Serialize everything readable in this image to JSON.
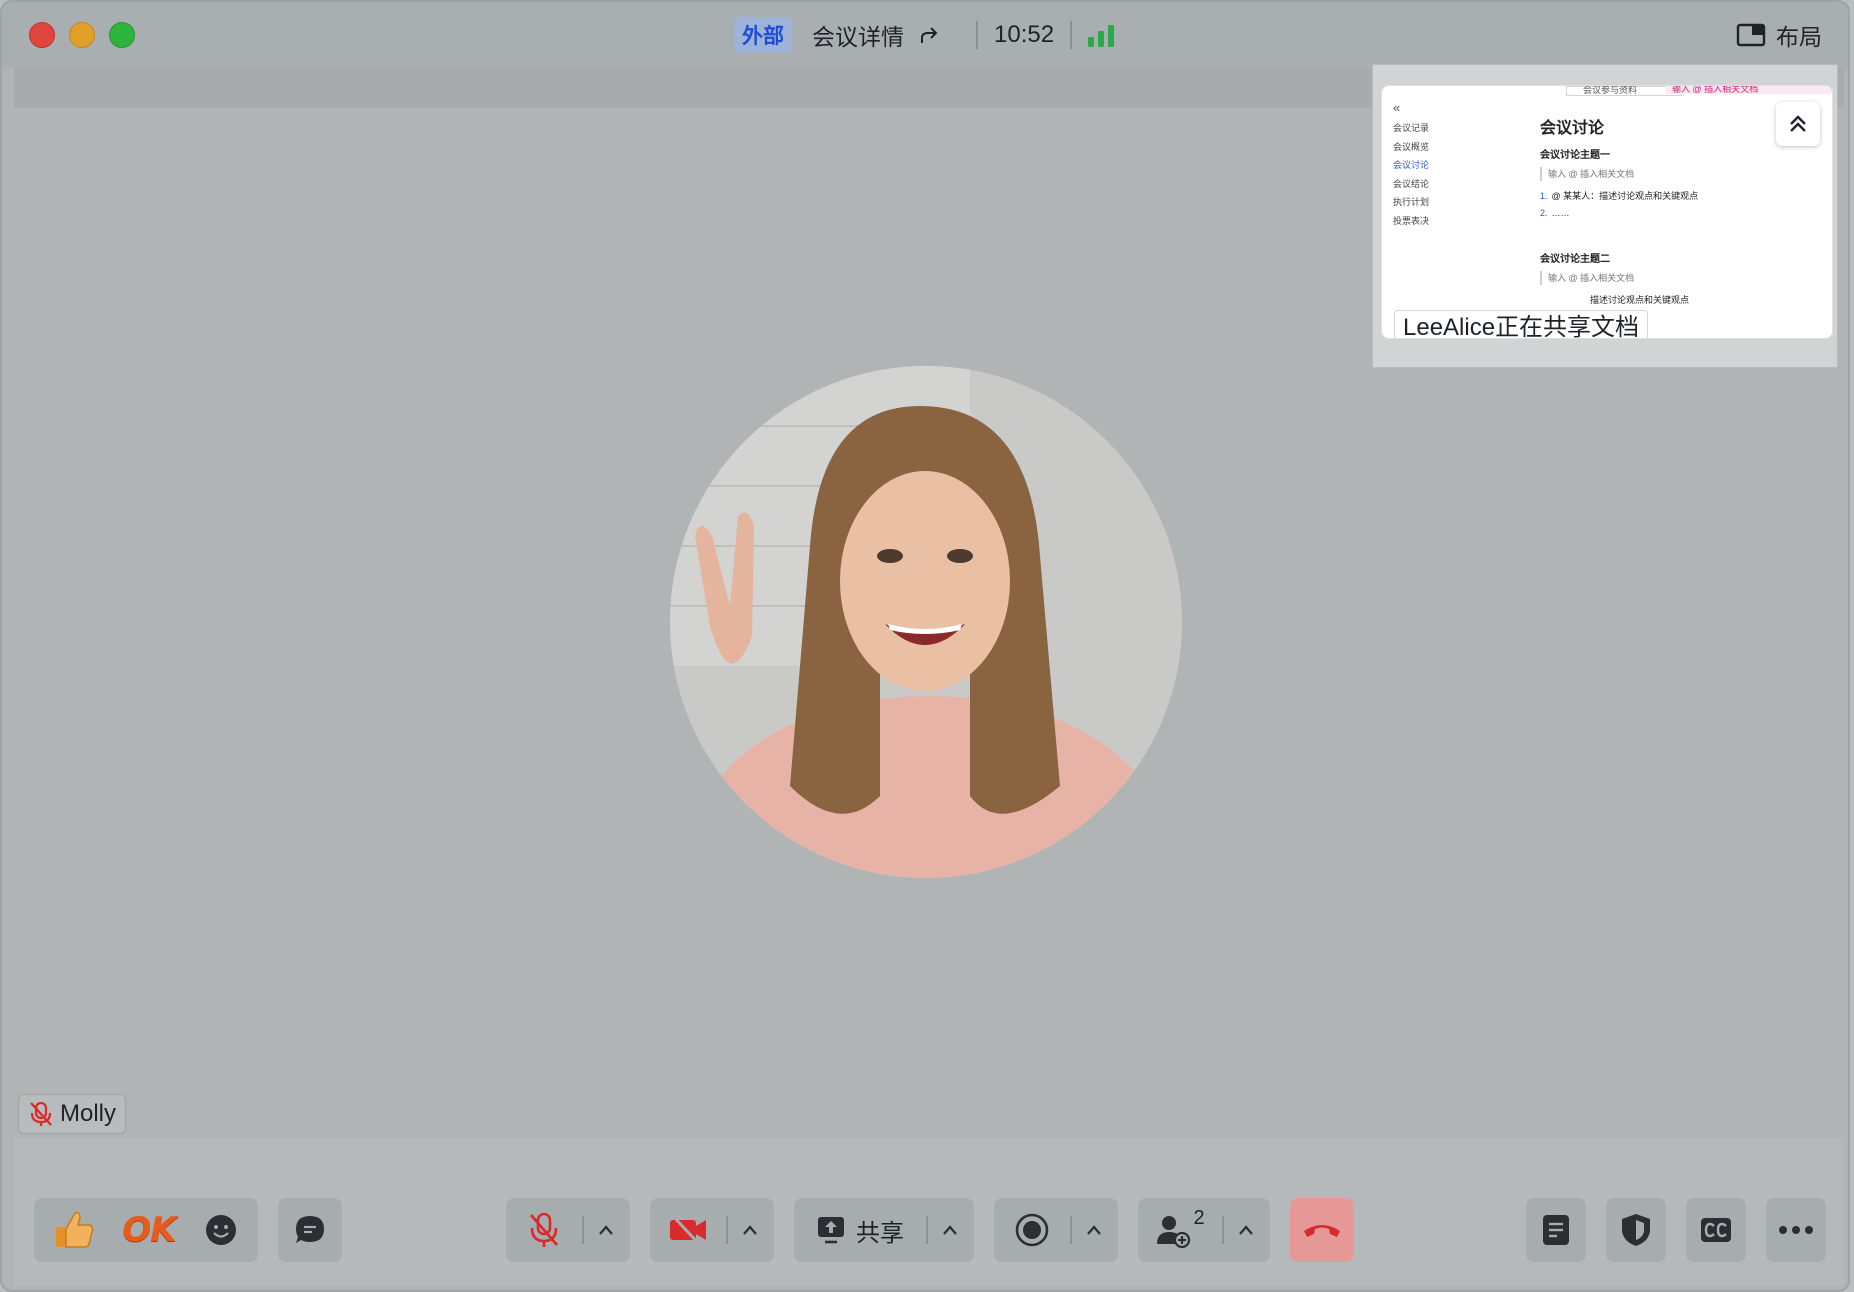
{
  "window": {
    "badge": "外部",
    "meeting_title": "会议详情",
    "clock": "10:52",
    "layout_label": "布局"
  },
  "participant": {
    "name": "Molly",
    "muted": true
  },
  "share": {
    "label": "LeeAlice正在共享文档",
    "doc": {
      "toolbar_left": "会议参与资料",
      "toolbar_right": "输入 @ 插入相关文档",
      "toc": [
        "会议记录",
        "会议概览",
        "会议讨论",
        "会议结论",
        "执行计划",
        "投票表决"
      ],
      "toc_active_index": 2,
      "heading": "会议讨论",
      "topic1": "会议讨论主题一",
      "placeholder1": "输入 @ 插入相关文档",
      "item1_num": "1.",
      "item1": "@ 某某人：描述讨论观点和关键观点",
      "item2_num": "2.",
      "item2": "……",
      "topic2": "会议讨论主题二",
      "placeholder2": "输入 @ 插入相关文档",
      "item3": "描述讨论观点和关键观点"
    }
  },
  "toolbar": {
    "reaction_ok": "OK",
    "share_label": "共享",
    "participants_count": "2"
  },
  "colors": {
    "accent_blue": "#1d4fd6",
    "signal_green": "#2ca84a",
    "mute_red": "#d92b2b",
    "end_call_bg": "#e59896"
  }
}
